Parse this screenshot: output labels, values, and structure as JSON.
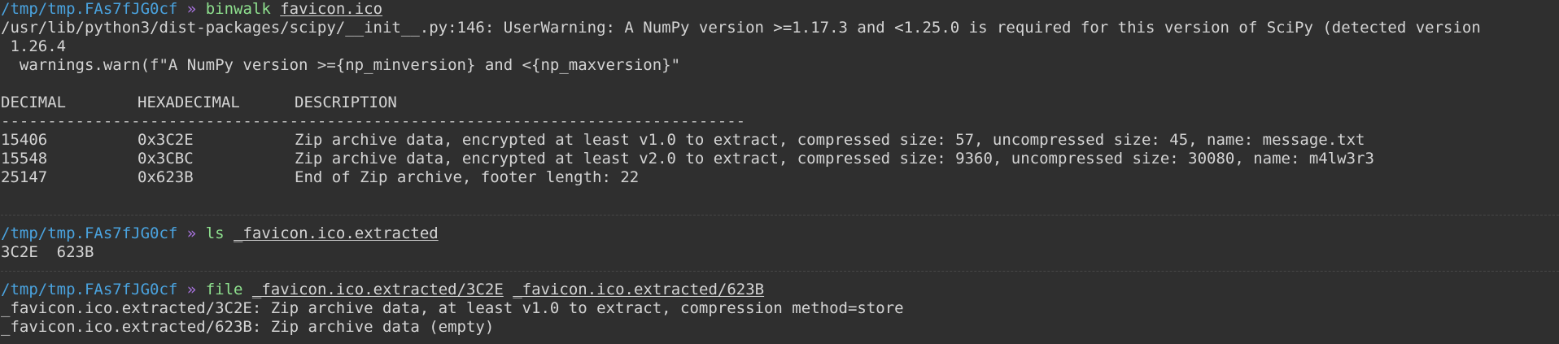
{
  "terminal": {
    "block1": {
      "prompt_path": "/tmp/tmp.FAs7fJG0cf",
      "prompt_sep": "»",
      "command": "binwalk",
      "arg": "favicon.ico",
      "warning_line1": "/usr/lib/python3/dist-packages/scipy/__init__.py:146: UserWarning: A NumPy version >=1.17.3 and <1.25.0 is required for this version of SciPy (detected version",
      "warning_line2": " 1.26.4",
      "warning_line3": "  warnings.warn(f\"A NumPy version >={np_minversion} and <{np_maxversion}\"",
      "headers": [
        "DECIMAL",
        "HEXADECIMAL",
        "DESCRIPTION"
      ],
      "dash_line": "--------------------------------------------------------------------------------",
      "rows": [
        {
          "dec": "15406",
          "hex": "0x3C2E",
          "desc": "Zip archive data, encrypted at least v1.0 to extract, compressed size: 57, uncompressed size: 45, name: message.txt"
        },
        {
          "dec": "15548",
          "hex": "0x3CBC",
          "desc": "Zip archive data, encrypted at least v2.0 to extract, compressed size: 9360, uncompressed size: 30080, name: m4lw3r3"
        },
        {
          "dec": "25147",
          "hex": "0x623B",
          "desc": "End of Zip archive, footer length: 22"
        }
      ]
    },
    "block2": {
      "prompt_path": "/tmp/tmp.FAs7fJG0cf",
      "prompt_sep": "»",
      "command": "ls",
      "arg": "_favicon.ico.extracted",
      "output": "3C2E  623B"
    },
    "block3": {
      "prompt_path": "/tmp/tmp.FAs7fJG0cf",
      "prompt_sep": "»",
      "command": "file",
      "arg1": "_favicon.ico.extracted/3C2E",
      "arg2": "_favicon.ico.extracted/623B",
      "output_line1": "_favicon.ico.extracted/3C2E: Zip archive data, at least v1.0 to extract, compression method=store",
      "output_line2": "_favicon.ico.extracted/623B: Zip archive data (empty)"
    }
  }
}
